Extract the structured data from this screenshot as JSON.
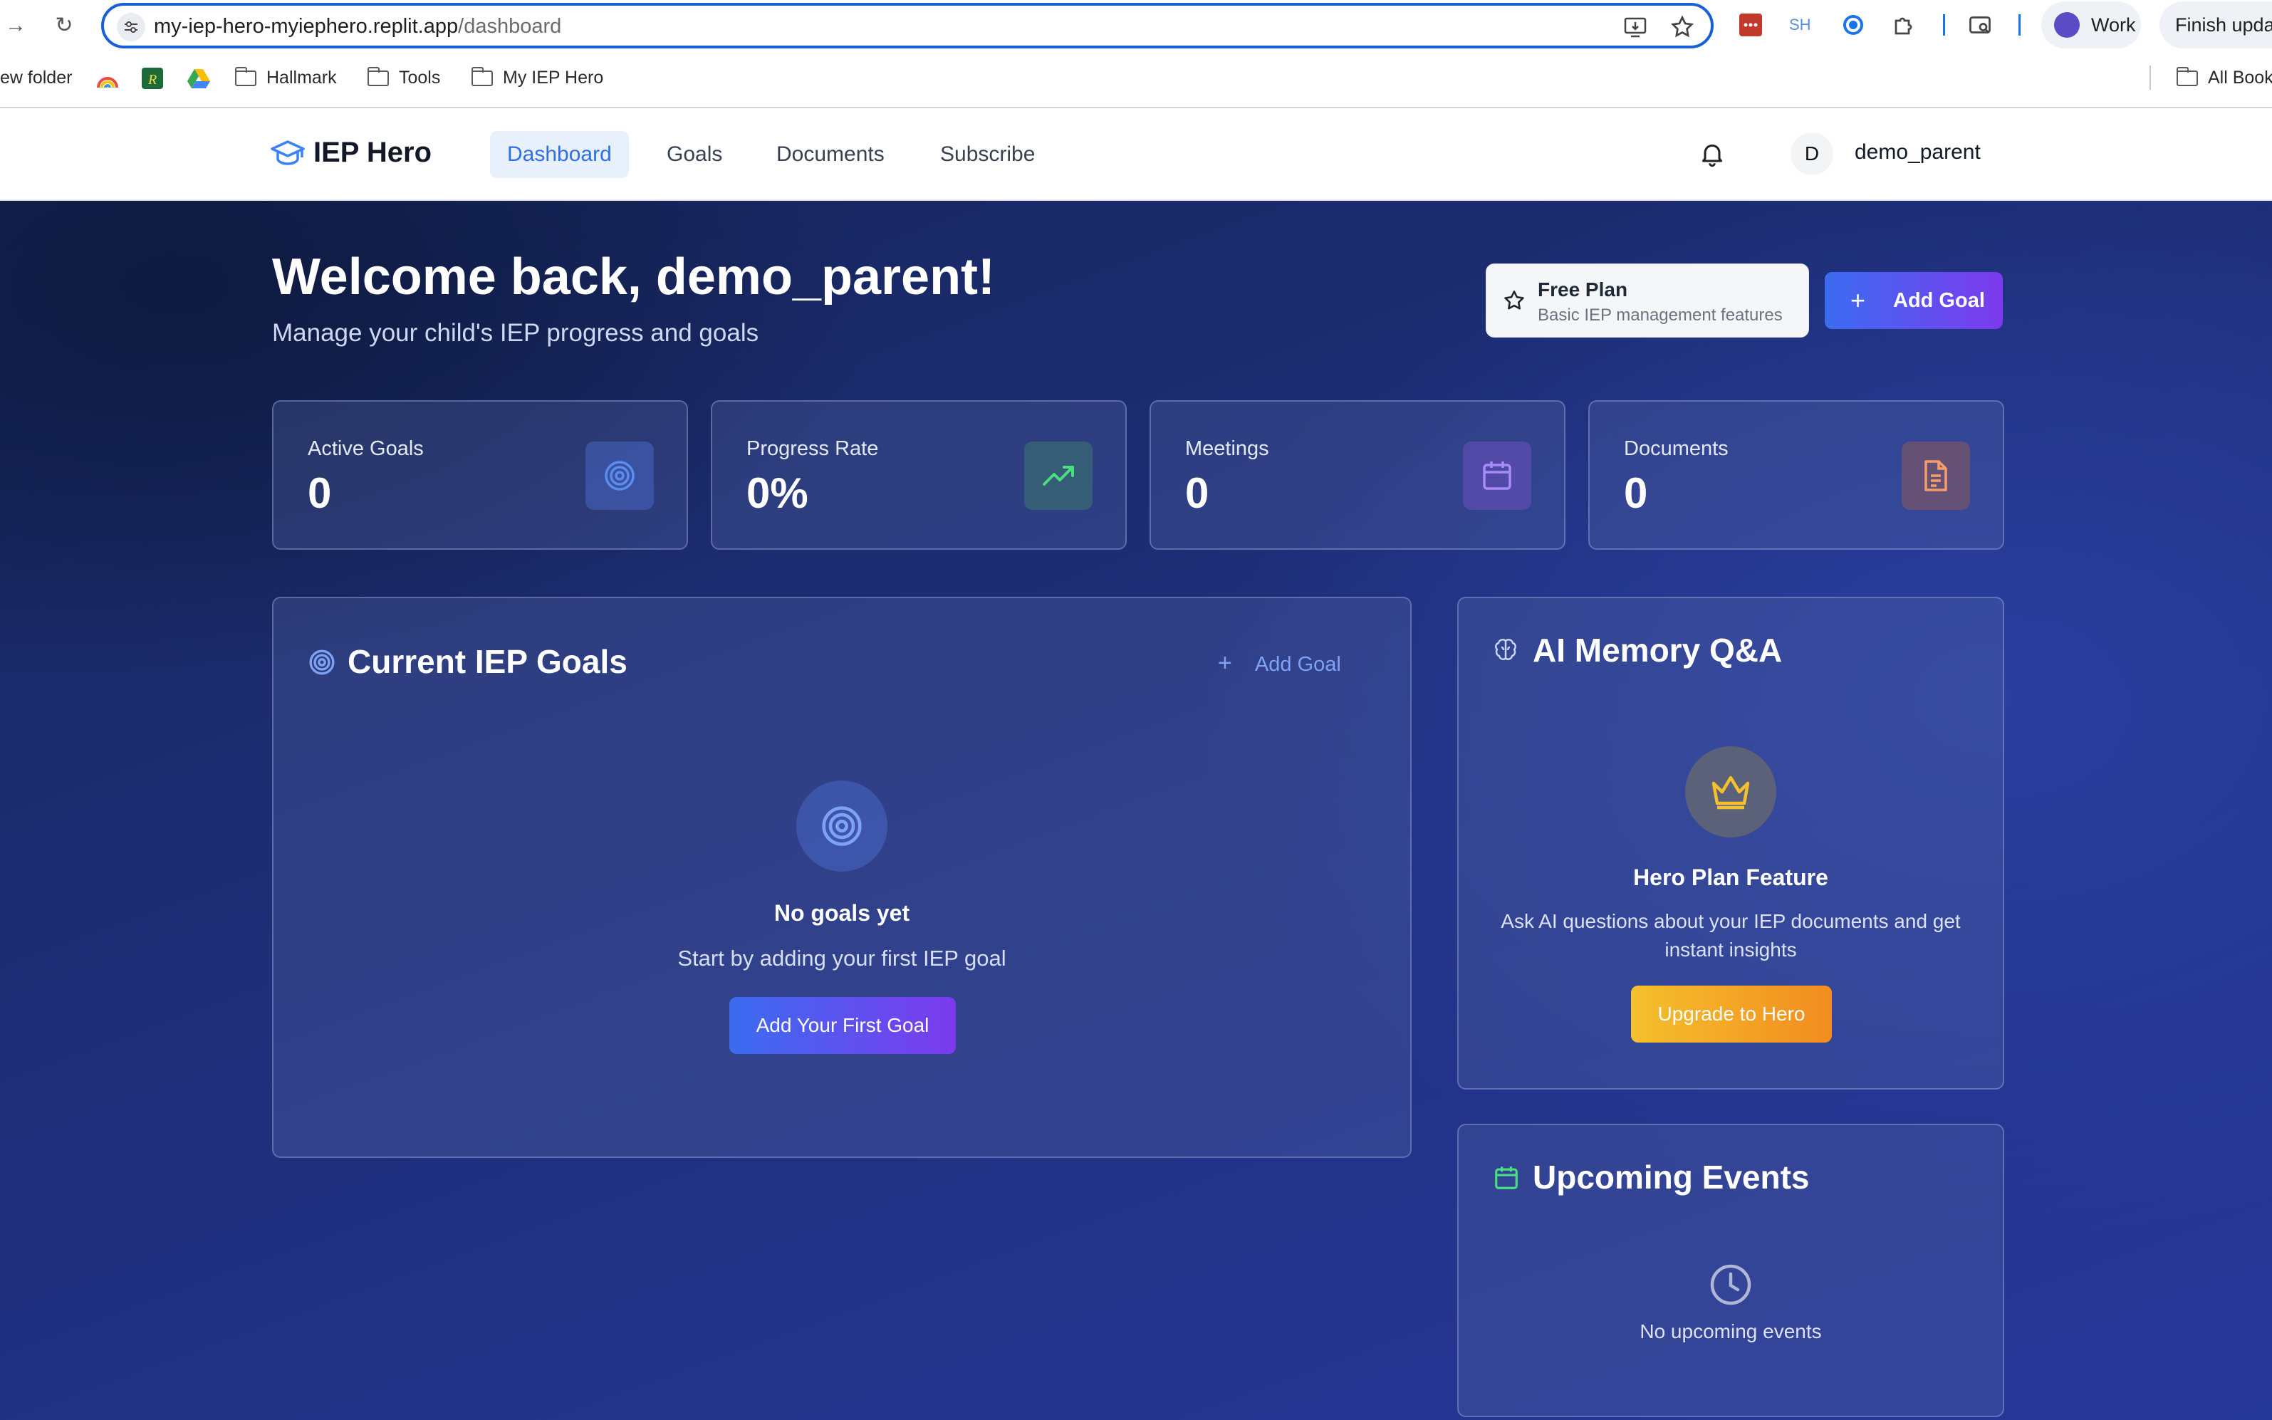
{
  "browser": {
    "url_domain": "my-iep-hero-myiephero.replit.app",
    "url_path": "/dashboard",
    "profile_label": "Work",
    "update_label": "Finish upda",
    "ext_sh_label": "SH",
    "bookmarks": [
      {
        "label": "ew folder",
        "icon": "folder-icon"
      },
      {
        "label": "",
        "icon": "rainbow-icon"
      },
      {
        "label": "",
        "icon": "r-logo-icon"
      },
      {
        "label": "",
        "icon": "drive-icon"
      },
      {
        "label": "Hallmark",
        "icon": "folder-icon"
      },
      {
        "label": "Tools",
        "icon": "folder-icon"
      },
      {
        "label": "My IEP Hero",
        "icon": "folder-icon"
      }
    ],
    "all_bookmarks_label": "All Book"
  },
  "header": {
    "brand": "IEP Hero",
    "nav": [
      {
        "label": "Dashboard",
        "active": true
      },
      {
        "label": "Goals",
        "active": false
      },
      {
        "label": "Documents",
        "active": false
      },
      {
        "label": "Subscribe",
        "active": false
      }
    ],
    "avatar_initial": "D",
    "username": "demo_parent"
  },
  "welcome": {
    "title": "Welcome back, demo_parent!",
    "subtitle": "Manage your child's IEP progress and goals"
  },
  "plan": {
    "name": "Free Plan",
    "description": "Basic IEP management features"
  },
  "add_goal_button": "Add Goal",
  "stats": [
    {
      "label": "Active Goals",
      "value": "0",
      "icon": "target-icon",
      "color": "#5b8df0"
    },
    {
      "label": "Progress Rate",
      "value": "0%",
      "icon": "trending-up-icon",
      "color": "#4ade80"
    },
    {
      "label": "Meetings",
      "value": "0",
      "icon": "calendar-icon",
      "color": "#a78bfa"
    },
    {
      "label": "Documents",
      "value": "0",
      "icon": "document-icon",
      "color": "#f59e6b"
    }
  ],
  "goals_panel": {
    "title": "Current IEP Goals",
    "add_link": "Add Goal",
    "empty_title": "No goals yet",
    "empty_text": "Start by adding your first IEP goal",
    "cta": "Add Your First Goal"
  },
  "ai_panel": {
    "title": "AI Memory Q&A",
    "feature_title": "Hero Plan Feature",
    "feature_desc": "Ask AI questions about your IEP documents and get instant insights",
    "cta": "Upgrade to Hero"
  },
  "events_panel": {
    "title": "Upcoming Events",
    "empty_text": "No upcoming events"
  }
}
